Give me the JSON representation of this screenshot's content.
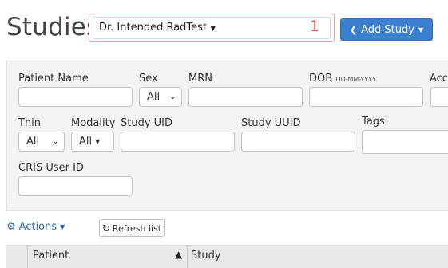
{
  "page": {
    "title": "Studies"
  },
  "header": {
    "user_select_label": "Dr. Intended RadTest",
    "user_select_badge": "1",
    "add_study_label": "Add Study"
  },
  "filters": {
    "patient_name_label": "Patient Name",
    "sex_label": "Sex",
    "sex_value": "All",
    "mrn_label": "MRN",
    "dob_label": "DOB",
    "dob_hint": "DD-MM-YYYY",
    "acc_label": "Acc",
    "thin_label": "Thin",
    "thin_value": "All",
    "modality_label": "Modality",
    "modality_value": "All",
    "study_uid_label": "Study UID",
    "study_uuid_label": "Study UUID",
    "tags_label": "Tags",
    "cris_user_id_label": "CRIS User ID"
  },
  "toolbar": {
    "actions_label": "Actions",
    "refresh_label": "Refresh list"
  },
  "table": {
    "columns": [
      "Patient",
      "Study"
    ]
  },
  "colors": {
    "accent": "#3b7fd0",
    "badge": "#e44b4b"
  }
}
